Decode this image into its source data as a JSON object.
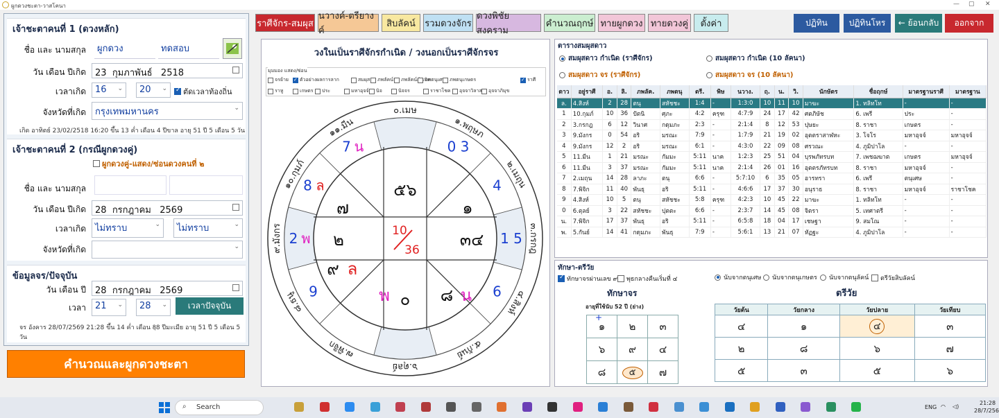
{
  "window": {
    "title": "ผูกดวงชะตา-วาสโคนา"
  },
  "left": {
    "g1": {
      "title": "เจ้าชะตาคนที่ 1 (ดวงหลัก)",
      "name_label": "ชื่อ และ นามสกุล",
      "first_name": "ผูกดวง",
      "last_name": "ทดสอบ",
      "date_label": "วัน เดือน ปีเกิด",
      "day": "23",
      "month": "กุมภาพันธ์",
      "year": "2518",
      "time_label": "เวลาเกิด",
      "hour": "16",
      "minute": "20",
      "local_time_label": "ตัดเวลาท้องถิ่น",
      "province_label": "จังหวัดที่เกิด",
      "province": "กรุงเทพมหานคร",
      "info": "เกิด อาทิตย์ 23/02/2518 16:20 ขึ้น 13 ค่ำ เดือน 4 ปีขาล อายุ 51 ปี 5 เดือน 5 วัน"
    },
    "g2": {
      "title": "เจ้าชะตาคนที่ 2 (กรณีผูกดวงคู่)",
      "toggle_label": "ผูกดวงคู่-แสดง/ซ่อนดวงคนที่ ๒",
      "name_label": "ชื่อ และ นามสกุล",
      "date_label": "วัน เดือน ปีเกิด",
      "day": "28",
      "month": "กรกฎาคม",
      "year": "2569",
      "time_label": "เวลาเกิด",
      "hour": "ไม่ทราบ",
      "minute": "ไม่ทราบ",
      "province_label": "จังหวัดที่เกิด"
    },
    "g3": {
      "title": "ข้อมูลจร/ปัจจุบัน",
      "date_label": "วัน เดือน ปี",
      "day": "28",
      "month": "กรกฎาคม",
      "year": "2569",
      "time_label": "เวลา",
      "hour": "21",
      "minute": "28",
      "now_button": "เวลาปัจจุบัน",
      "info": "จร อังคาร 28/07/2569 21:28 ขึ้น 14 ค่ำ เดือน 8ฺ8 ปีมะเมีย อายุ 51 ปี 5 เดือน 5 วัน"
    },
    "calc_button": "คำนวณและผูกดวงชะตา"
  },
  "tabs": [
    {
      "label": "ราศีจักร-สมผุส",
      "bg": "#c8282e",
      "fg": "#ffffff"
    },
    {
      "label": "นวางค์-ตรียางค์",
      "bg": "#f5c896",
      "fg": "#222222"
    },
    {
      "label": "สิบลัคน์",
      "bg": "#f8e8a0",
      "fg": "#222222"
    },
    {
      "label": "รวมดวงจักร",
      "bg": "#bfe0f3",
      "fg": "#222222"
    },
    {
      "label": "ดวงพิชัยสงคราม",
      "bg": "#d7b8e0",
      "fg": "#222222"
    },
    {
      "label": "คำนวณฤกษ์",
      "bg": "#cbeed0",
      "fg": "#222222"
    },
    {
      "label": "ทายผูกดวง",
      "bg": "#f2c6d8",
      "fg": "#222222"
    },
    {
      "label": "ทายดวงคู่",
      "bg": "#f2c6d8",
      "fg": "#222222"
    },
    {
      "label": "ตั้งค่า",
      "bg": "#c8ecee",
      "fg": "#222222"
    }
  ],
  "top_buttons": [
    {
      "label": "ปฏิทิน",
      "bg": "#2c5aa0"
    },
    {
      "label": "ปฏิทินโหร",
      "bg": "#2c5aa0"
    },
    {
      "label": "← ย้อนกลับ",
      "bg": "#2a7a7a"
    },
    {
      "label": "ออกจาก",
      "bg": "#c8282e"
    }
  ],
  "chart": {
    "title": "วงในเป็นราศีจักรกำเนิด / วงนอกเป็นราศีจักรจร",
    "options_title": "มุมมอง แสดง/ซ่อน",
    "options": [
      {
        "label": "จรย้าย",
        "on": false
      },
      {
        "label": "ตัวอย่างผลการลาก",
        "on": true
      },
      {
        "label": "สมผุส",
        "on": false
      },
      {
        "label": "ภพลัคน์จร",
        "on": false
      },
      {
        "label": "ภพลัคน์กำเนิด",
        "on": false
      },
      {
        "label": "ภพตนุเศษ",
        "on": false
      },
      {
        "label": "ภพตนุเกษตร",
        "on": false
      },
      {
        "label": "ราศี",
        "on": true
      },
      {
        "label": "ราหู",
        "on": false
      },
      {
        "label": "เกษตร",
        "on": false
      },
      {
        "label": "ประ",
        "on": false
      },
      {
        "label": "มหาอุจจ์",
        "on": false
      },
      {
        "label": "นิจ",
        "on": false
      },
      {
        "label": "นิจจร",
        "on": false
      },
      {
        "label": "ราชาโชค",
        "on": false
      },
      {
        "label": "อุจจาวิลาส",
        "on": false
      },
      {
        "label": "อุจจาภิมุข",
        "on": false
      }
    ],
    "outer_labels": [
      "๐.เมษ",
      "๑๑.มีน",
      "๑๐.กุมภ์",
      "๙.มังกร",
      "๘.ธนู",
      "๗.พิจิก",
      "๖.ตุลย์",
      "๕.กันย์",
      "๔.สิงห์",
      "๓.กรกฎ",
      "๒.เมถุน",
      "๑.พฤษภ"
    ],
    "outer_planets": [
      {
        "idx": 1,
        "text": "7",
        "color": "#1a3fd0",
        "extra": "น",
        "extra_color": "#e020c0"
      },
      {
        "idx": 2,
        "text": "8",
        "color": "#1a3fd0",
        "extra": "ล",
        "extra_color": "#e02020"
      },
      {
        "idx": 3,
        "text": "2",
        "color": "#1a3fd0",
        "extra": "พ",
        "extra_color": "#e020c0"
      },
      {
        "idx": 4,
        "text": "9",
        "color": "#1a3fd0",
        "extra": "",
        "extra_color": ""
      },
      {
        "idx": 8,
        "text": "6",
        "color": "#1a3fd0",
        "extra": "",
        "extra_color": ""
      },
      {
        "idx": 9,
        "text": "1 5",
        "color": "#1a3fd0",
        "extra": "",
        "extra_color": ""
      },
      {
        "idx": 10,
        "text": "4",
        "color": "#1a3fd0",
        "extra": "",
        "extra_color": ""
      },
      {
        "idx": 11,
        "text": "0 3",
        "color": "#1a3fd0",
        "extra": "",
        "extra_color": ""
      }
    ],
    "inner": [
      {
        "pos": "top-center",
        "text": "๕๖",
        "color": "#111111"
      },
      {
        "pos": "top-right",
        "text": "๑",
        "color": "#111111"
      },
      {
        "pos": "top-left",
        "text": "๗",
        "color": "#111111"
      },
      {
        "pos": "mid-left",
        "text": "๒",
        "color": "#111111"
      },
      {
        "pos": "mid-right",
        "text": "๓๔",
        "color": "#111111"
      },
      {
        "pos": "bot-left",
        "text": "๙",
        "color": "#111111",
        "extra": "ล",
        "extra_color": "#e02020"
      },
      {
        "pos": "bot-left2",
        "text": "พ",
        "color": "#e020c0"
      },
      {
        "pos": "bot-center",
        "text": "๐",
        "color": "#111111"
      },
      {
        "pos": "bot-right",
        "text": "๘",
        "color": "#111111",
        "extra": "น",
        "extra_color": "#e020c0"
      }
    ],
    "center_top": "10",
    "center_bottom": "36",
    "accent": "#e02020"
  },
  "table": {
    "title": "ตารางสมผุสดาว",
    "radios": [
      {
        "label": "สมผุสดาว กำเนิด (ราศีจักร)",
        "on": true,
        "color": "#1a2a4a"
      },
      {
        "label": "สมผุสดาว กำเนิด (10 ลัคนา)",
        "on": false,
        "color": "#1a2a4a"
      },
      {
        "label": "สมผุสดาว จร (ราศีจักร)",
        "on": false,
        "color": "#c06000"
      },
      {
        "label": "สมผุสดาว จร (10 ลัคนา)",
        "on": false,
        "color": "#c06000"
      }
    ],
    "headers": [
      "ดาว",
      "อยู่ราศี",
      "อ.",
      "ลิ.",
      "ภพลัค.",
      "ภพตนุ",
      "ตรี.",
      "พิษ",
      "นวาง.",
      "ฤ.",
      "น.",
      "วิ.",
      "นักษัตร",
      "ชื่อฤกษ์",
      "มาตรฐานราศี",
      "มาตรฐาน"
    ],
    "rows": [
      [
        "ล.",
        "4.สิงห์",
        "2",
        "28",
        "ตนุ",
        "สหัชชะ",
        "1:4",
        "-",
        "1:3:0",
        "10",
        "11",
        "10",
        "มาฆะ",
        "1. ทลิทโท",
        "-",
        "-"
      ],
      [
        "1",
        "10.กุมภ์",
        "10",
        "36",
        "ปัตนิ",
        "ศุภะ",
        "4:2",
        "ครุฑ",
        "4:7:9",
        "24",
        "17",
        "42",
        "ศตภิษัช",
        "6. เพรี",
        "ประ",
        "-"
      ],
      [
        "2",
        "3.กรกฎ",
        "6",
        "12",
        "วินาศ",
        "กดุมภะ",
        "2:3",
        "-",
        "2:1:4",
        "8",
        "12",
        "53",
        "ปุษยะ",
        "8. ราชา",
        "เกษตร",
        "-"
      ],
      [
        "3",
        "9.มังกร",
        "0",
        "54",
        "อริ",
        "มรณะ",
        "7:9",
        "-",
        "1:7:9",
        "21",
        "19",
        "02",
        "อุตตราสาฬหะ",
        "3. โจโร",
        "มหาอุจจ์",
        "มหาอุจจ์"
      ],
      [
        "4",
        "9.มังกร",
        "12",
        "2",
        "อริ",
        "มรณะ",
        "6:1",
        "-",
        "4:3:0",
        "22",
        "09",
        "08",
        "ศรวณะ",
        "4. ภูมิปาโล",
        "-",
        "-"
      ],
      [
        "5",
        "11.มีน",
        "1",
        "21",
        "มรณะ",
        "กัมมะ",
        "5:11",
        "นาค",
        "1:2:3",
        "25",
        "51",
        "04",
        "บุรพภัทรบท",
        "7. เพชฌฆาต",
        "เกษตร",
        "มหาอุจจ์"
      ],
      [
        "6",
        "11.มีน",
        "3",
        "37",
        "มรณะ",
        "กัมมะ",
        "5:11",
        "นาค",
        "2:1:4",
        "26",
        "01",
        "16",
        "อุตตรภัทรบท",
        "8. ราชา",
        "มหาอุจจ์",
        "-"
      ],
      [
        "7",
        "2.เมถุน",
        "14",
        "28",
        "ลาภะ",
        "ตนุ",
        "6:6",
        "-",
        "5:7:10",
        "6",
        "35",
        "05",
        "อารทรา",
        "6. เพรี",
        "ตนุเศษ",
        "-"
      ],
      [
        "8",
        "7.พิจิก",
        "11",
        "40",
        "พันธุ",
        "อริ",
        "5:11",
        "-",
        "4:6:6",
        "17",
        "37",
        "30",
        "อนุราธ",
        "8. ราชา",
        "มหาอุจจ์",
        "ราชาโชค"
      ],
      [
        "9",
        "4.สิงห์",
        "10",
        "5",
        "ตนุ",
        "สหัชชะ",
        "5:8",
        "ครุฑ",
        "4:2:3",
        "10",
        "45",
        "22",
        "มาฆะ",
        "1. ทลิทโท",
        "-",
        "-"
      ],
      [
        "0",
        "6.ตุลย์",
        "3",
        "22",
        "สหัชชะ",
        "ปุตตะ",
        "6:6",
        "-",
        "2:3:7",
        "14",
        "45",
        "08",
        "จิตรา",
        "5. เทศาตรี",
        "-",
        "-"
      ],
      [
        "น.",
        "7.พิจิก",
        "17",
        "37",
        "พันธุ",
        "อริ",
        "5:11",
        "-",
        "6:5:8",
        "18",
        "04",
        "17",
        "เชษฐา",
        "9. สมโณ",
        "-",
        "-"
      ],
      [
        "พ.",
        "5.กันย์",
        "14",
        "41",
        "กดุมภะ",
        "พันธุ",
        "7:9",
        "-",
        "5:6:1",
        "13",
        "21",
        "07",
        "หัฏฐะ",
        "4. ภูมิปาโล",
        "-",
        "-"
      ]
    ]
  },
  "taksa": {
    "title": "ทักษา-ตรีวัย",
    "options": [
      {
        "label": "ทักษาจรผ่านเลข ๙",
        "on": true
      },
      {
        "label": "พุธกลางคืนเริ่มที่ ๔",
        "on": false
      }
    ],
    "radios": [
      {
        "label": "นับจากตนุเศษ",
        "on": true
      },
      {
        "label": "นับจากตนุเกษตร",
        "on": false
      },
      {
        "label": "นับจากตนุลัคน์",
        "on": false
      }
    ],
    "trivai_check": "ตรีวัยสิบลัคน์",
    "takjon_title": "ทักษาจร",
    "takjon_sub": "อายุที่ใช้นับ 52 ปี (ย่าง)",
    "takjon_grid": [
      [
        "๑",
        "๒",
        "๓"
      ],
      [
        "๖",
        "๙",
        "๔"
      ],
      [
        "๘",
        "๕",
        "๗"
      ]
    ],
    "plus": "+",
    "trivai_title": "ตรีวัย",
    "trivai_headers": [
      "วัยต้น",
      "วัยกลาง",
      "วัยปลาย",
      "วัยเทียบ"
    ],
    "trivai_rows": [
      [
        "๔",
        "๑",
        "๔",
        "๓"
      ],
      [
        "๒",
        "๘",
        "๖",
        "๗"
      ],
      [
        "๕",
        "๓",
        "๕",
        "๖"
      ]
    ]
  },
  "taskbar": {
    "search": "Search",
    "lang": "ENG",
    "time": "21:28",
    "date": "28/7/2569"
  }
}
